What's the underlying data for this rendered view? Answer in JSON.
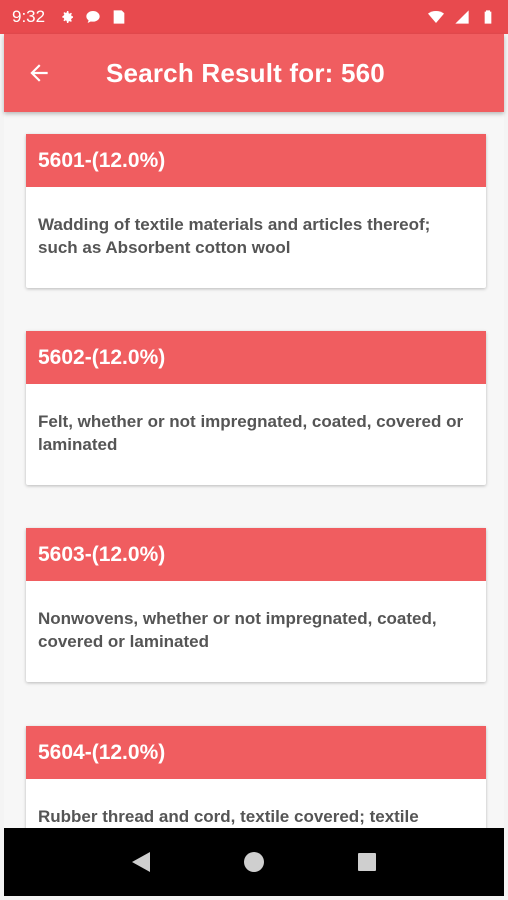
{
  "status_bar": {
    "time": "9:32",
    "left_icons": [
      "settings-icon",
      "chat-icon",
      "sim-card-icon"
    ],
    "right_icons": [
      "wifi-icon",
      "signal-icon",
      "battery-icon"
    ]
  },
  "app_bar": {
    "title": "Search Result for: 560",
    "back_icon": "arrow-back-icon"
  },
  "results": [
    {
      "code": "5601-(12.0%)",
      "description": "Wadding of textile materials and articles thereof; such as Absorbent cotton wool"
    },
    {
      "code": "5602-(12.0%)",
      "description": "Felt, whether or not impregnated, coated, covered or laminated"
    },
    {
      "code": "5603-(12.0%)",
      "description": "Nonwovens, whether or not impregnated, coated, covered or laminated"
    },
    {
      "code": "5604-(12.0%)",
      "description": "Rubber thread and cord, textile covered; textile"
    }
  ],
  "nav_bar": {
    "buttons": [
      "back-triangle-icon",
      "home-circle-icon",
      "recents-square-icon"
    ]
  },
  "colors": {
    "status_bar": "#e84a4e",
    "app_bar": "#f05d60",
    "card_header": "#f05d60",
    "card_text": "#555555",
    "nav_bar": "#000000"
  }
}
